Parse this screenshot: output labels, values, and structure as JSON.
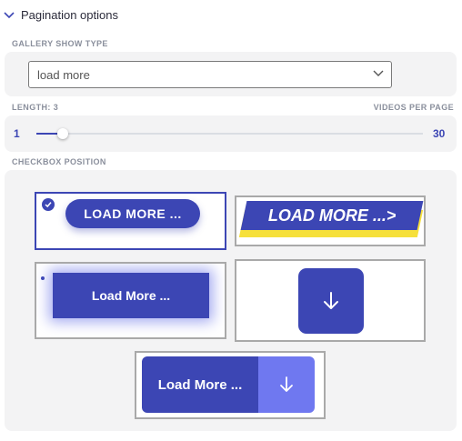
{
  "section": {
    "title": "Pagination options",
    "icon": "chevron-down-icon"
  },
  "gallery_show_type": {
    "label": "GALLERY SHOW TYPE",
    "selected": "load more"
  },
  "length": {
    "label": "LENGTH: 3",
    "right_label": "VIDEOS PER PAGE",
    "min": "1",
    "max": "30",
    "value": 3
  },
  "checkbox_position": {
    "label": "CHECKBOX POSITION",
    "options": [
      {
        "text": "LOAD MORE ...",
        "selected": true
      },
      {
        "text": "LOAD MORE ...>",
        "selected": false
      },
      {
        "text": "Load More ...",
        "selected": false
      },
      {
        "text": "",
        "icon": "arrow-down-icon",
        "selected": false
      },
      {
        "text": "Load More ...",
        "icon": "arrow-down-icon",
        "selected": false
      }
    ]
  },
  "colors": {
    "accent": "#3c46b4",
    "accent_light": "#6f78f0",
    "highlight": "#f6e03a",
    "panel": "#f3f3f4"
  }
}
